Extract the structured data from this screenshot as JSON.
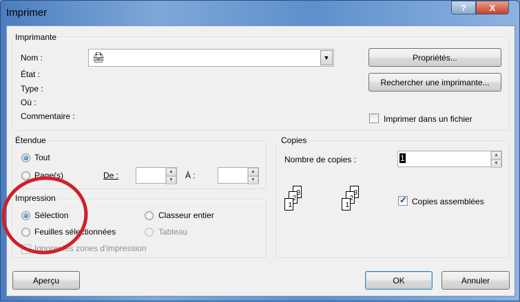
{
  "window": {
    "title": "Imprimer",
    "help": "?",
    "close": "X"
  },
  "printer": {
    "group": "Imprimante",
    "name_label": "Nom :",
    "state_label": "État :",
    "type_label": "Type :",
    "where_label": "Où :",
    "comment_label": "Commentaire :",
    "properties": "Propriétés...",
    "find": "Rechercher une imprimante...",
    "print_to_file": "Imprimer dans un fichier",
    "print_to_file_checked": false
  },
  "range": {
    "group": "Étendue",
    "all": "Tout",
    "pages": "Page(s)",
    "from": "De :",
    "to": "À :",
    "selected": "all"
  },
  "print_what": {
    "group": "Impression",
    "selection": "Sélection",
    "whole": "Classeur entier",
    "sheets": "Feuilles sélectionnées",
    "table": "Tableau",
    "ignore": "Ignorer les zones d'impression",
    "selected": "selection"
  },
  "copies": {
    "group": "Copies",
    "count_label": "Nombre de copies :",
    "count": "1",
    "collate": "Copies assemblées",
    "collate_checked": true,
    "pages": [
      "1",
      "2",
      "3"
    ]
  },
  "buttons": {
    "preview": "Aperçu",
    "ok": "OK",
    "cancel": "Annuler"
  },
  "annotation_color": "#d0202a"
}
